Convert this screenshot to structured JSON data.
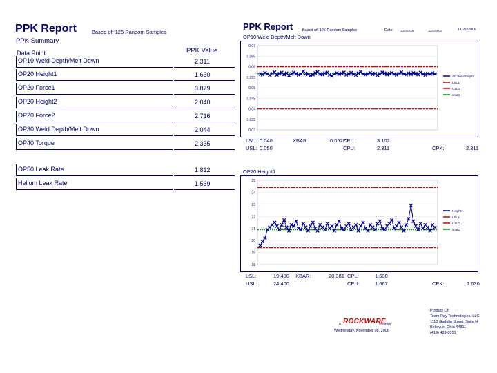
{
  "left": {
    "title": "PPK Report",
    "subtitle": "Based off 125 Random Samples",
    "summary_label": "PPK Summary",
    "col_data_point": "Data Point",
    "col_ppk_value": "PPK Value",
    "rows": [
      {
        "label": "OP10 Weld Depth/Melt Down",
        "value": "2.311"
      },
      {
        "label": "OP20 Height1",
        "value": "1.630"
      },
      {
        "label": "OP20 Force1",
        "value": "3.879"
      },
      {
        "label": "OP20 Height2",
        "value": "2.040"
      },
      {
        "label": "OP20 Force2",
        "value": "2.716"
      },
      {
        "label": "OP30 Weld Depth/Melt Down",
        "value": "2.044"
      },
      {
        "label": "OP40 Torque",
        "value": "2.335"
      },
      {
        "label": "OP50 Leak Rate",
        "value": "1.812"
      },
      {
        "label": "Helium Leak Rate",
        "value": "1.569"
      }
    ]
  },
  "right": {
    "title": "PPK Report",
    "subtitle": "Based off 125 Random Samples",
    "date_label": "Date:",
    "date_from": "10/23/2006",
    "date_to": "11/20/2006",
    "date_end": "11/21/2006",
    "footer_company_prefix": "a",
    "footer_logo": "ROCKWARE",
    "footer_solution": "solution",
    "footer_date": "Wednesday, November 08, 2006",
    "product_of": "Product Of:",
    "company": "Team Ray Technologies, LLC",
    "address1": "1110 Gadulia Street, Suite H",
    "address2": "Bellevue, Ohio 44811",
    "phone": "(419) 483-0151"
  },
  "chart_data": [
    {
      "type": "line",
      "title": "OP10 Weld Depth/Melt Down",
      "y_ticks": [
        "0.07",
        "0.065",
        "0.06",
        "0.055",
        "0.05",
        "0.045",
        "0.04",
        "0.035",
        "0.03"
      ],
      "ylim": [
        0.03,
        0.07
      ],
      "series": [
        {
          "name": "AD Weld Depth",
          "color": "#000099",
          "values": [
            0.0565,
            0.0562,
            0.0571,
            0.0566,
            0.0559,
            0.0568,
            0.0574,
            0.0561,
            0.0567,
            0.0572,
            0.0563,
            0.0569,
            0.0558,
            0.0566,
            0.0573,
            0.0567,
            0.0561,
            0.0566,
            0.0578,
            0.0568,
            0.0564,
            0.0557,
            0.0562,
            0.057,
            0.0575,
            0.0566,
            0.0563,
            0.0569,
            0.0572,
            0.0561,
            0.0556,
            0.0566,
            0.057,
            0.0564,
            0.0568,
            0.0573,
            0.0561,
            0.0566,
            0.0571,
            0.0565,
            0.056,
            0.0569,
            0.0576,
            0.0566,
            0.0562,
            0.0567,
            0.0571,
            0.0564,
            0.0568,
            0.056,
            0.0566,
            0.0573,
            0.0569,
            0.0563,
            0.0567,
            0.0571,
            0.0565,
            0.0561,
            0.0568,
            0.0574,
            0.0566,
            0.0562,
            0.0569,
            0.0564,
            0.057,
            0.0567,
            0.0563,
            0.0572,
            0.0566,
            0.0561,
            0.0568,
            0.0564,
            0.057,
            0.0566
          ]
        },
        {
          "name": "LSL1",
          "color": "#cc0000",
          "value": 0.04
        },
        {
          "name": "USL1",
          "color": "#cc0000",
          "value": 0.06
        },
        {
          "name": "xbar1",
          "color": "#009900",
          "value": 0.0567
        }
      ],
      "stats": {
        "LSL": "0.040",
        "XBAR": "0.0527",
        "CPL": "3.102",
        "USL": "0.050",
        "CPU": "2.311",
        "CPK": "2.311"
      }
    },
    {
      "type": "line",
      "title": "OP20 Height1",
      "y_ticks": [
        "25",
        "24",
        "23",
        "22",
        "21",
        "20",
        "19",
        "18"
      ],
      "ylim": [
        18,
        25
      ],
      "series": [
        {
          "name": "Height1",
          "color": "#000099",
          "values": [
            19.6,
            19.9,
            20.2,
            20.9,
            21.1,
            21.3,
            21.5,
            21.2,
            20.9,
            21.3,
            21.7,
            21.1,
            20.8,
            21.3,
            21.2,
            21.6,
            21.0,
            20.9,
            21.4,
            21.1,
            20.8,
            21.2,
            21.5,
            21.0,
            20.8,
            21.3,
            21.1,
            20.9,
            21.4,
            21.0,
            21.2,
            20.8,
            21.3,
            21.6,
            21.0,
            20.9,
            21.2,
            21.4,
            20.9,
            21.1,
            21.3,
            20.8,
            21.2,
            21.5,
            21.0,
            20.8,
            21.3,
            21.1,
            20.9,
            21.4,
            21.6,
            21.0,
            20.9,
            21.2,
            21.4,
            21.7,
            21.0,
            21.2,
            21.5,
            21.1,
            20.8,
            21.3,
            21.8,
            22.9,
            21.6,
            21.2,
            20.9,
            21.4,
            21.0,
            21.3,
            21.1,
            20.8,
            21.3,
            21.1
          ]
        },
        {
          "name": "LSL1",
          "color": "#cc0000",
          "value": 19.4
        },
        {
          "name": "USL1",
          "color": "#cc0000",
          "value": 24.4
        },
        {
          "name": "xbar1",
          "color": "#009900",
          "value": 20.9
        }
      ],
      "stats": {
        "LSL": "19.400",
        "XBAR": "20.381",
        "CPL": "1.630",
        "USL": "24.400",
        "CPU": "1.667",
        "CPK": "1.630"
      }
    }
  ]
}
